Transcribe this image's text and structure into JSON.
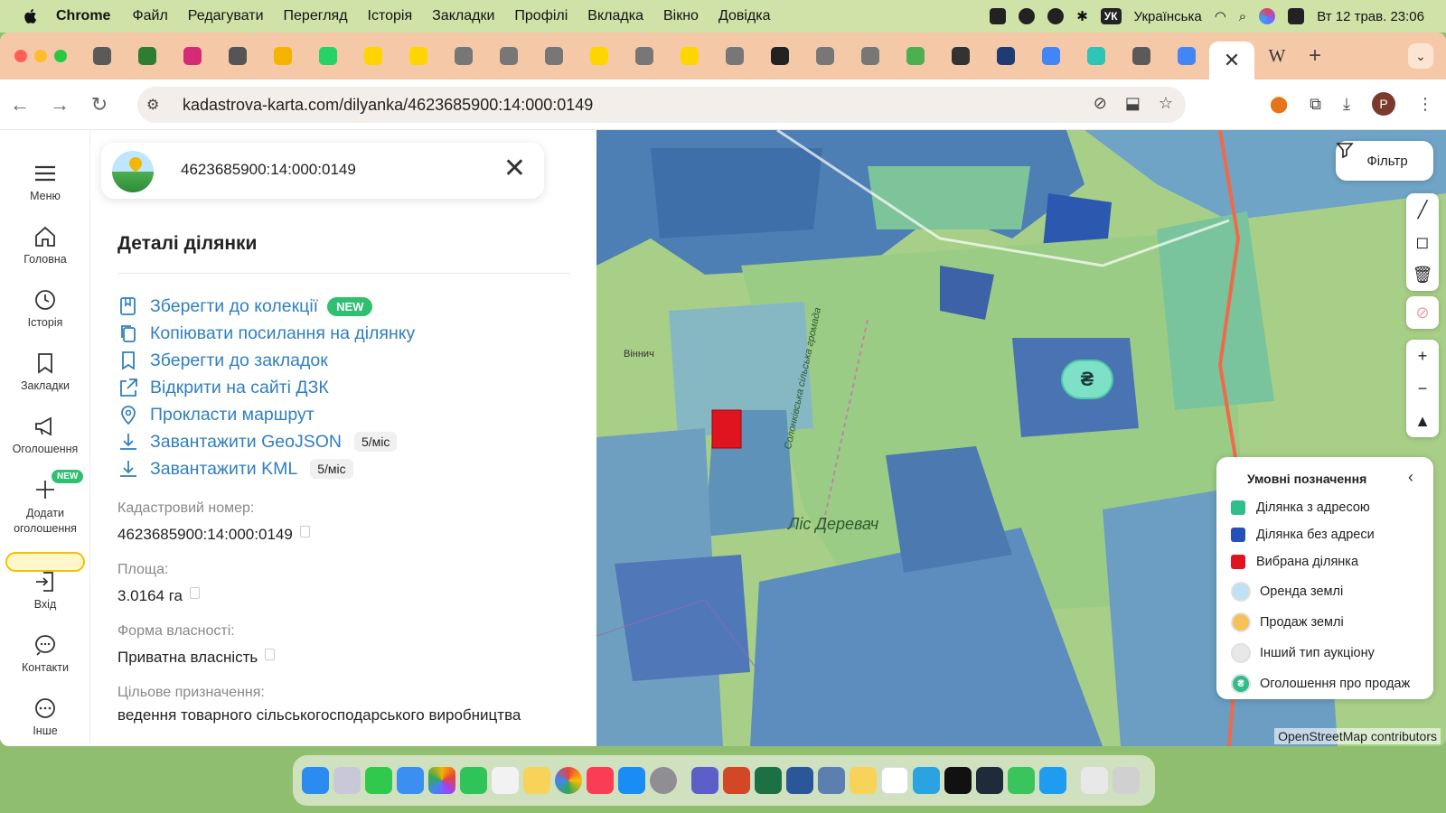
{
  "menubar": {
    "app": "Chrome",
    "items": [
      "Файл",
      "Редагувати",
      "Перегляд",
      "Історія",
      "Закладки",
      "Профілі",
      "Вкладка",
      "Вікно",
      "Довідка"
    ],
    "lang_badge": "УК",
    "lang": "Українська",
    "datetime": "Вт 12 трав.  23:06"
  },
  "tabs": {
    "favicon_colors": [
      "#5a5a5a",
      "#2e7d32",
      "#d62976",
      "#555555",
      "#f4b400",
      "#25d366",
      "#ffd500",
      "#ffd500",
      "#777777",
      "#777777",
      "#777777",
      "#ffd500",
      "#777777",
      "#ffd500",
      "#777777",
      "#222222",
      "#777777",
      "#777777",
      "#4caf50",
      "#333333",
      "#1f3b73",
      "#4285f4",
      "#2ec4b6",
      "#5a5a5a",
      "#4285f4"
    ],
    "active_close": "✕",
    "extra_tab_letter": "W",
    "new_tab": "+",
    "menu_chevron": "⌄"
  },
  "toolbar": {
    "url": "kadastrova-karta.com/dilyanka/4623685900:14:000:0149",
    "avatar_letter": "P"
  },
  "leftnav": {
    "items": [
      {
        "label": "Меню",
        "icon": "menu-icon"
      },
      {
        "label": "Головна",
        "icon": "home-icon"
      },
      {
        "label": "Історія",
        "icon": "clock-icon"
      },
      {
        "label": "Закладки",
        "icon": "bookmark-icon"
      },
      {
        "label": "Оголошення",
        "icon": "megaphone-icon"
      },
      {
        "label": "Додати оголошення",
        "icon": "plus-icon",
        "badge": "NEW"
      },
      {
        "label": "Вхід",
        "icon": "login-icon"
      },
      {
        "label": "Контакти",
        "icon": "chat-icon"
      },
      {
        "label": "Інше",
        "icon": "more-icon"
      }
    ]
  },
  "search": {
    "query": "4623685900:14:000:0149"
  },
  "panel": {
    "title": "Деталі ділянки",
    "actions": {
      "save_collection": "Зберегти до колекції",
      "new_badge": "NEW",
      "copy_link": "Копіювати посилання на ділянку",
      "save_bookmarks": "Зберегти до закладок",
      "open_dzk": "Відкрити на сайті ДЗК",
      "route": "Прокласти маршрут",
      "geojson": "Завантажити GeoJSON",
      "geojson_rate": "5/міс",
      "kml": "Завантажити KML",
      "kml_rate": "5/міс"
    },
    "fields": {
      "cadastral_label": "Кадастровий номер:",
      "cadastral_value": "4623685900:14:000:0149",
      "area_label": "Площа:",
      "area_value": "3.0164 га",
      "ownership_label": "Форма власності:",
      "ownership_value": "Приватна власність",
      "purpose_label": "Цільове призначення:",
      "purpose_value": "ведення товарного сільськогосподарського виробництва"
    }
  },
  "map": {
    "filter_label": "Фільтр",
    "forest_label": "Ліс Деревач",
    "road_label": "Солонківська сільська громада",
    "village_label": "Віннич",
    "attribution": "OpenStreetMap contributors",
    "hryvnia_marker": "₴",
    "legend": {
      "title": "Умовні позначення",
      "rows": [
        {
          "label": "Ділянка з адресою",
          "color": "#2fbf8a"
        },
        {
          "label": "Ділянка без адреси",
          "color": "#2450b8"
        },
        {
          "label": "Вибрана ділянка",
          "color": "#e0141e"
        },
        {
          "label": "Оренда землі",
          "color": "#bfe0f5"
        },
        {
          "label": "Продаж землі",
          "color": "#f7c15a"
        },
        {
          "label": "Інший тип аукціону",
          "color": "#e8e8e8"
        },
        {
          "label": "Оголошення про продаж",
          "color": "#2fbf8a",
          "glyph": "₴"
        }
      ]
    }
  }
}
